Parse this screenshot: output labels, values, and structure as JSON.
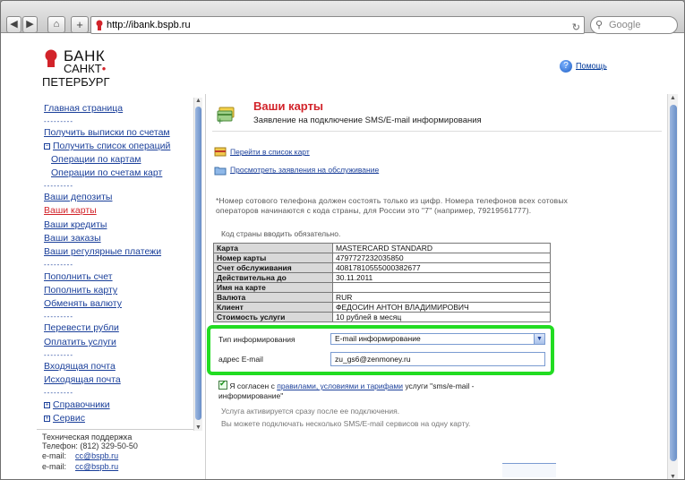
{
  "browser": {
    "url": "http://ibank.bspb.ru",
    "search_placeholder": "Google"
  },
  "logo": {
    "line1": "БАНК",
    "line2": "САНКТ",
    "line3": "ПЕТЕРБУРГ"
  },
  "help_label": "Помощь",
  "sidebar": {
    "main": "Главная страница",
    "statements": "Получить выписки по счетам",
    "operations": "Получить список операций",
    "ops_cards": "Операции по картам",
    "ops_card_accounts": "Операции по счетам карт",
    "deposits": "Ваши депозиты",
    "cards": "Ваши карты",
    "credits": "Ваши кредиты",
    "orders": "Ваши заказы",
    "regular_payments": "Ваши регулярные платежи",
    "topup_account": "Пополнить счет",
    "topup_card": "Пополнить карту",
    "exchange": "Обменять валюту",
    "transfer_rub": "Перевести рубли",
    "pay_services": "Оплатить услуги",
    "inbox": "Входящая почта",
    "outbox": "Исходящая почта",
    "references": "Справочники",
    "service": "Сервис",
    "separator": "---------",
    "support_title": "Техническая поддержка",
    "support_phone": "Телефон: (812) 329-50-50",
    "email_label": "e-mail:",
    "email1": "cc@bspb.ru",
    "email2": "cc@bspb.ru"
  },
  "main": {
    "title": "Ваши карты",
    "subtitle": "Заявление на подключение SMS/E-mail информирования",
    "action1": "Перейти в список карт",
    "action2": "Просмотреть заявления на обслуживание",
    "note": "*Номер сотового телефона должен состоять только из цифр. Номера телефонов всех сотовых операторов начинаются с кода страны, для России это \"7\" (например, 79219561777).",
    "note2": "Код страны вводить обязательно.",
    "table": [
      {
        "k": "Карта",
        "v": "MASTERCARD STANDARD"
      },
      {
        "k": "Номер карты",
        "v": "4797727232035850"
      },
      {
        "k": "Счет обслуживания",
        "v": "40817810555000382677"
      },
      {
        "k": "Действительна до",
        "v": "30.11.2011"
      },
      {
        "k": "Имя на карте",
        "v": ""
      },
      {
        "k": "Валюта",
        "v": "RUR"
      },
      {
        "k": "Клиент",
        "v": "ФЕДОСИН АНТОН ВЛАДИМИРОВИЧ"
      },
      {
        "k": "Стоимость услуги",
        "v": "10 рублей в месяц"
      }
    ],
    "info_type_label": "Тип информирования",
    "info_type_value": "E-mail информирование",
    "email_label": "адрес E-mail",
    "email_value": "zu_gs6@zenmoney.ru",
    "agree_pre": "Я согласен с",
    "agree_link": "правилами, условиями и тарифами",
    "agree_post": "услуги \"sms/e-mail - информирование\"",
    "info1": "Услуга активируется сразу после ее подключения.",
    "info2": "Вы можете подключать несколько SMS/E-mail сервисов на одну карту."
  },
  "colors": {
    "brand_red": "#d2232a",
    "link_blue": "#1a3f9a",
    "highlight_green": "#22dc22"
  }
}
